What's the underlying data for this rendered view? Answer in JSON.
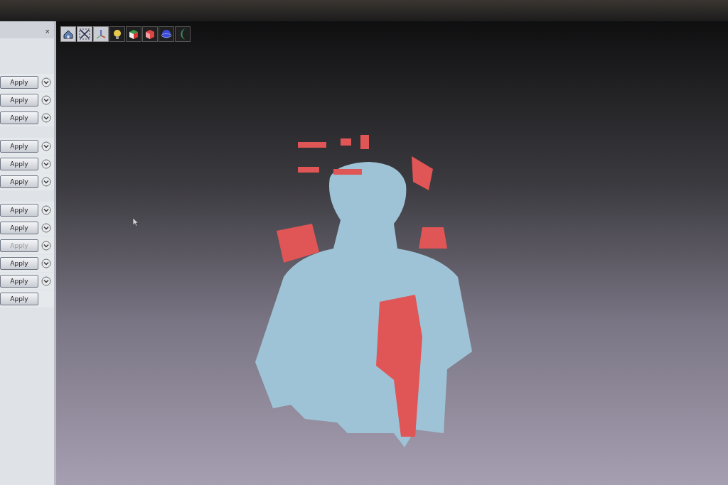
{
  "panel": {
    "close": "×",
    "groups": [
      {
        "rows": [
          {
            "label": "Apply",
            "disabled": false,
            "expander": true
          },
          {
            "label": "Apply",
            "disabled": false,
            "expander": true
          },
          {
            "label": "Apply",
            "disabled": false,
            "expander": true
          }
        ]
      },
      {
        "rows": [
          {
            "label": "Apply",
            "disabled": false,
            "expander": true
          },
          {
            "label": "Apply",
            "disabled": false,
            "expander": true
          },
          {
            "label": "Apply",
            "disabled": false,
            "expander": true
          }
        ]
      },
      {
        "rows": [
          {
            "label": "Apply",
            "disabled": false,
            "expander": true
          },
          {
            "label": "Apply",
            "disabled": false,
            "expander": true
          },
          {
            "label": "Apply",
            "disabled": true,
            "expander": true
          },
          {
            "label": "Apply",
            "disabled": false,
            "expander": true
          },
          {
            "label": "Apply",
            "disabled": false,
            "expander": true
          },
          {
            "label": "Apply",
            "disabled": false,
            "expander": false
          }
        ]
      }
    ]
  },
  "toolbar": [
    {
      "kind": "home",
      "on": true
    },
    {
      "kind": "fit",
      "on": true
    },
    {
      "kind": "axes",
      "on": true
    },
    {
      "kind": "light",
      "on": false
    },
    {
      "kind": "cube-color",
      "on": false
    },
    {
      "kind": "cube",
      "on": false
    },
    {
      "kind": "sphere",
      "on": false
    },
    {
      "kind": "moon",
      "on": false
    }
  ]
}
